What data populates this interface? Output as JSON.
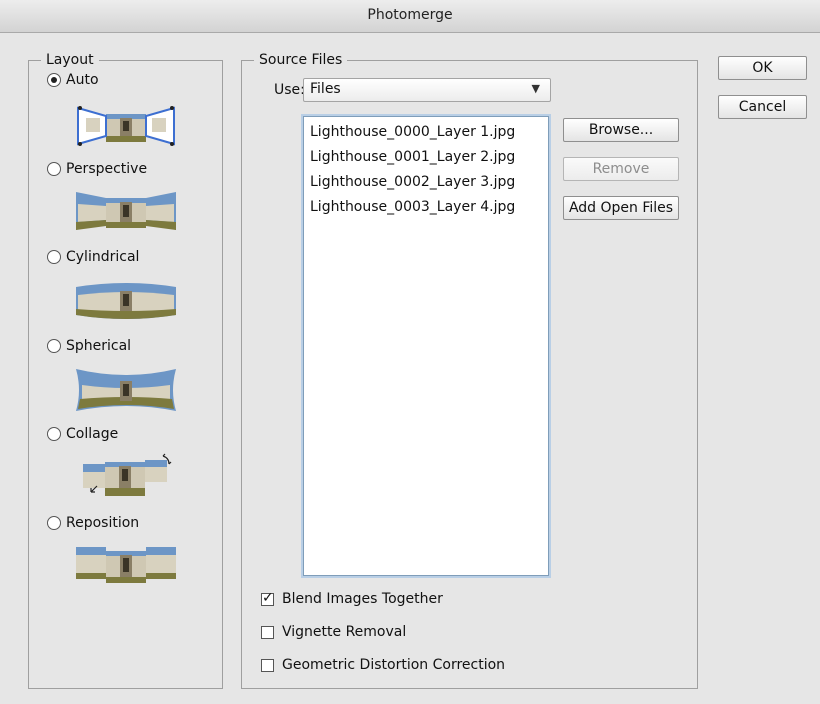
{
  "window": {
    "title": "Photomerge"
  },
  "layout": {
    "title": "Layout",
    "options": [
      {
        "label": "Auto",
        "selected": true
      },
      {
        "label": "Perspective",
        "selected": false
      },
      {
        "label": "Cylindrical",
        "selected": false
      },
      {
        "label": "Spherical",
        "selected": false
      },
      {
        "label": "Collage",
        "selected": false
      },
      {
        "label": "Reposition",
        "selected": false
      }
    ]
  },
  "source": {
    "title": "Source Files",
    "use_label": "Use:",
    "use_value": "Files",
    "files": [
      "Lighthouse_0000_Layer 1.jpg",
      "Lighthouse_0001_Layer 2.jpg",
      "Lighthouse_0002_Layer 3.jpg",
      "Lighthouse_0003_Layer 4.jpg"
    ],
    "browse_label": "Browse...",
    "remove_label": "Remove",
    "add_open_label": "Add Open Files"
  },
  "buttons": {
    "ok": "OK",
    "cancel": "Cancel"
  },
  "options": {
    "blend": {
      "label": "Blend Images Together",
      "checked": true
    },
    "vignette": {
      "label": "Vignette Removal",
      "checked": false
    },
    "geometric": {
      "label": "Geometric Distortion Correction",
      "checked": false
    }
  },
  "colors": {
    "sky": "#6d96c6",
    "building": "#cfc8b3",
    "ground": "#7d7a3e",
    "accent": "#3d6fd1"
  }
}
